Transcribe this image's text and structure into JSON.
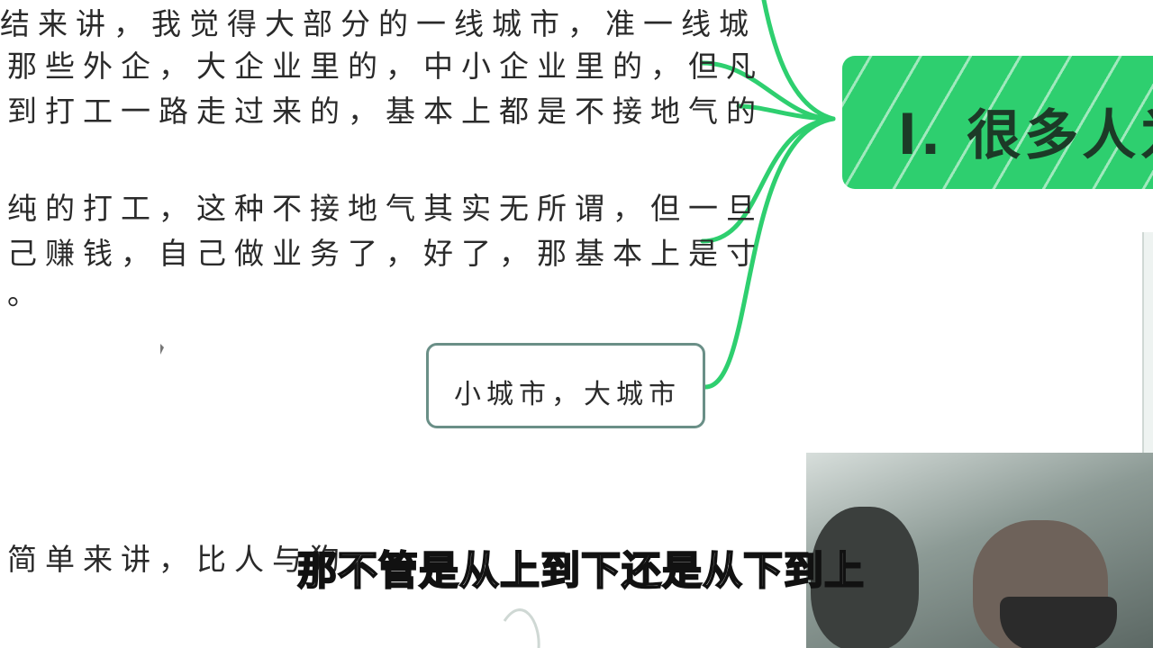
{
  "mindmap": {
    "heading": "l. 很多人为",
    "branches": [
      {
        "lines": [
          "结来讲，我觉得大部分的一线城市，准一线城",
          "那些外企，大企业里的，中小企业里的，但凡",
          "到打工一路走过来的，基本上都是不接地气的"
        ]
      },
      {
        "lines": [
          "纯的打工，这种不接地气其实无所谓，但一旦",
          "己赚钱，自己做业务了，好了，那基本上是寸",
          "。"
        ]
      }
    ],
    "city_node": "小城市，大城市",
    "bottom_text": "简单来讲，比人与狗"
  },
  "subtitle": "那不管是从上到下还是从下到上",
  "colors": {
    "connector": "#2ecf6f",
    "heading_fill": "#2ecf6f",
    "heading_text": "#1c3a27",
    "node_border": "#6a8f87",
    "text": "#2a2a2a"
  }
}
